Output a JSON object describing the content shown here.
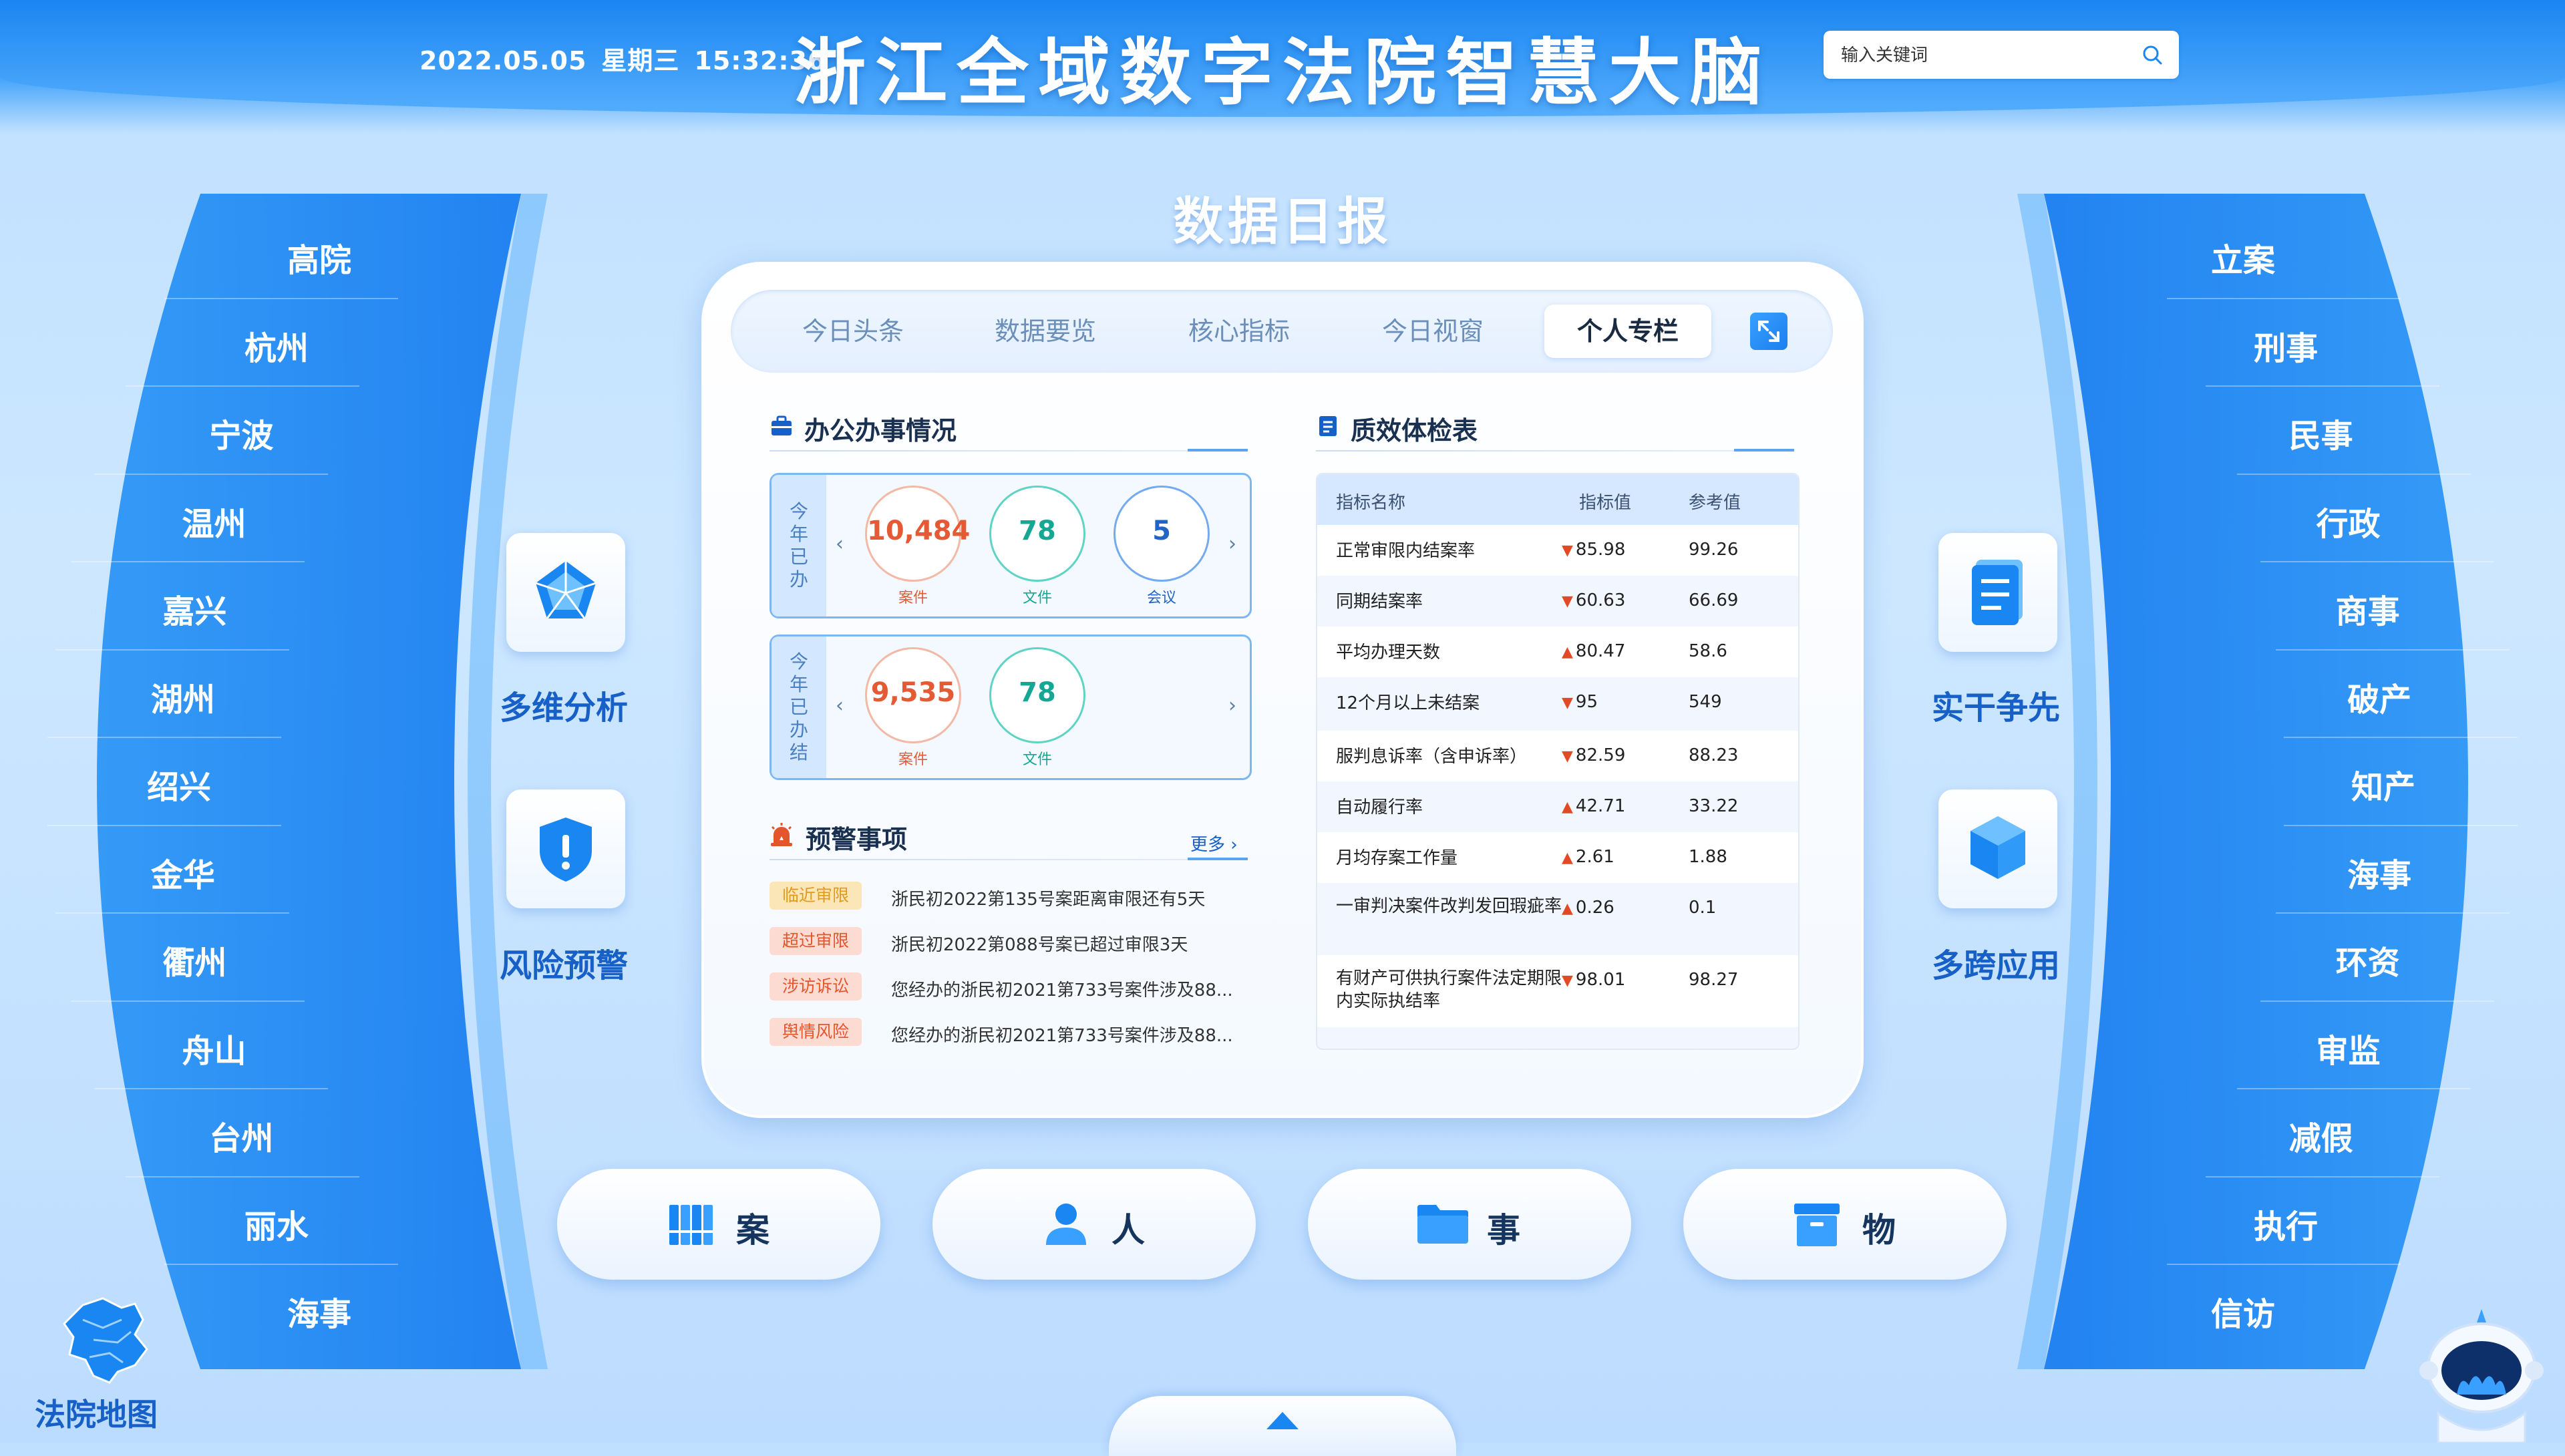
{
  "header": {
    "date": "2022.05.05",
    "weekday": "星期三",
    "time": "15:32:36",
    "title": "浙江全域数字法院智慧大脑",
    "search_placeholder": "输入关键词"
  },
  "left_nav": [
    "高院",
    "杭州",
    "宁波",
    "温州",
    "嘉兴",
    "湖州",
    "绍兴",
    "金华",
    "衢州",
    "舟山",
    "台州",
    "丽水",
    "海事"
  ],
  "right_nav": [
    "立案",
    "刑事",
    "民事",
    "行政",
    "商事",
    "破产",
    "知产",
    "海事",
    "环资",
    "审监",
    "减假",
    "执行",
    "信访"
  ],
  "section_title": "数据日报",
  "tabs": [
    "今日头条",
    "数据要览",
    "核心指标",
    "今日视窗",
    "个人专栏"
  ],
  "office": {
    "title": "办公办事情况",
    "box1": {
      "label": "今年已办",
      "items": [
        {
          "num": "10,484",
          "cap": "案件"
        },
        {
          "num": "78",
          "cap": "文件"
        },
        {
          "num": "5",
          "cap": "会议"
        }
      ]
    },
    "box2": {
      "label": "今年已办结",
      "items": [
        {
          "num": "9,535",
          "cap": "案件"
        },
        {
          "num": "78",
          "cap": "文件"
        }
      ]
    }
  },
  "warnings": {
    "title": "预警事项",
    "more": "更多",
    "items": [
      {
        "tag": "临近审限",
        "text": "浙民初2022第135号案距离审限还有5天",
        "tag_color": "#fbe6b8",
        "tag_text": "#e09a1c"
      },
      {
        "tag": "超过审限",
        "text": "浙民初2022第088号案已超过审限3天",
        "tag_color": "#fcdcd2",
        "tag_text": "#e4552c"
      },
      {
        "tag": "涉访诉讼",
        "text": "您经办的浙民初2021第733号案件涉及88...",
        "tag_color": "#fcdcd2",
        "tag_text": "#e4552c"
      },
      {
        "tag": "舆情风险",
        "text": "您经办的浙民初2021第733号案件涉及88...",
        "tag_color": "#fcdcd2",
        "tag_text": "#e4552c"
      }
    ]
  },
  "quality": {
    "title": "质效体检表",
    "headers": [
      "指标名称",
      "指标值",
      "参考值"
    ],
    "rows": [
      {
        "name": "正常审限内结案率",
        "dir": "down",
        "val": "85.98",
        "ref": "99.26"
      },
      {
        "name": "同期结案率",
        "dir": "down",
        "val": "60.63",
        "ref": "66.69"
      },
      {
        "name": "平均办理天数",
        "dir": "up",
        "val": "80.47",
        "ref": "58.6"
      },
      {
        "name": "12个月以上未结案",
        "dir": "down",
        "val": "95",
        "ref": "549"
      },
      {
        "name": "服判息诉率（含申诉率）",
        "dir": "down",
        "val": "82.59",
        "ref": "88.23"
      },
      {
        "name": "自动履行率",
        "dir": "up",
        "val": "42.71",
        "ref": "33.22"
      },
      {
        "name": "月均存案工作量",
        "dir": "up",
        "val": "2.61",
        "ref": "1.88"
      },
      {
        "name": "一审判决案件改判发回瑕疵率",
        "dir": "up",
        "val": "0.26",
        "ref": "0.1"
      },
      {
        "name": "有财产可供执行案件法定期限内实际执结率",
        "dir": "down",
        "val": "98.01",
        "ref": "98.27"
      }
    ]
  },
  "features": {
    "left": [
      {
        "label": "多维分析",
        "icon": "pentagon-radar-icon"
      },
      {
        "label": "风险预警",
        "icon": "shield-alert-icon"
      }
    ],
    "right": [
      {
        "label": "实干争先",
        "icon": "document-list-icon"
      },
      {
        "label": "多跨应用",
        "icon": "cube-icon"
      }
    ]
  },
  "bottom_buttons": [
    {
      "label": "案",
      "icon": "binders-icon"
    },
    {
      "label": "人",
      "icon": "person-icon"
    },
    {
      "label": "事",
      "icon": "folder-icon"
    },
    {
      "label": "物",
      "icon": "box-icon"
    }
  ],
  "map_label": "法院地图",
  "colors": {
    "accent": "#1a86f2",
    "red": "#e35a35",
    "teal": "#14a894"
  }
}
